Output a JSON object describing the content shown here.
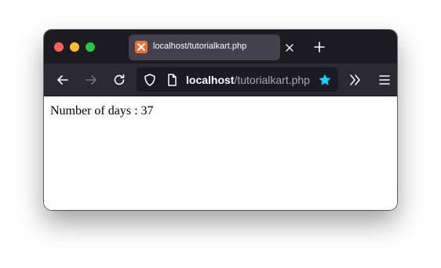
{
  "window": {
    "traffic_lights": [
      "close",
      "minimize",
      "zoom"
    ]
  },
  "tab": {
    "title": "localhost/tutorialkart.php",
    "favicon": "xampp-icon"
  },
  "toolbar": {
    "icons": [
      "back-arrow-icon",
      "forward-arrow-icon",
      "reload-icon",
      "shield-icon",
      "page-icon",
      "star-icon",
      "overflow-chevrons-icon",
      "menu-icon"
    ]
  },
  "address_bar": {
    "host": "localhost",
    "path": "/tutorialkart.php"
  },
  "page": {
    "text": "Number of days : 37"
  },
  "colors": {
    "titlebar": "#1c1b22",
    "tab_active": "#42414d",
    "toolbar": "#2b2a33",
    "star_accent": "#00ddff"
  }
}
